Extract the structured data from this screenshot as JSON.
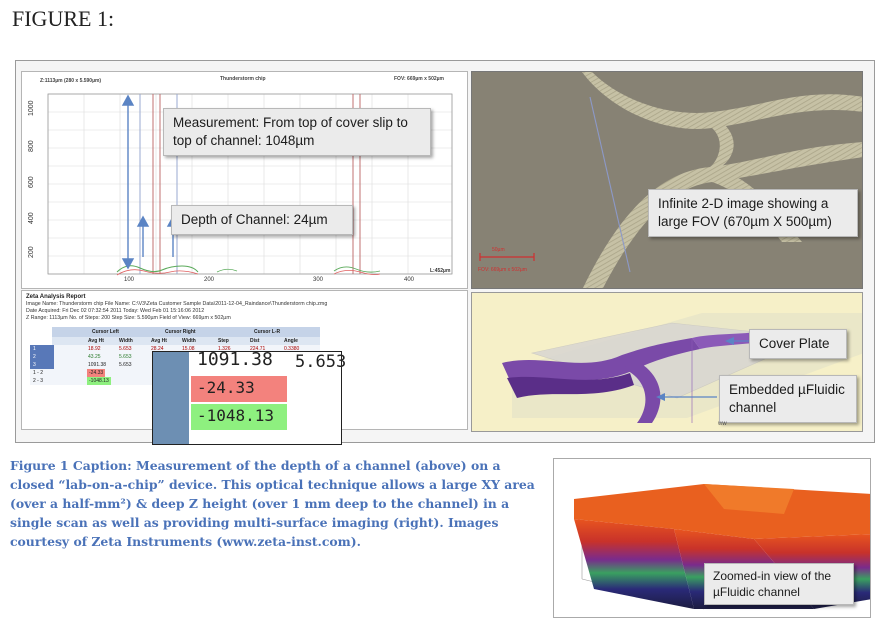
{
  "figure_title": "FIGURE 1:",
  "plot": {
    "left_header": "Z:1113µm (280 x 5.590µm)",
    "center_header": "Thunderstorm chip",
    "right_header": "FOV: 669µm x 502µm",
    "y_ticks": [
      "1000",
      "800",
      "600",
      "400",
      "200"
    ],
    "x_ticks": [
      "100",
      "200",
      "300",
      "400"
    ],
    "length_label": "L:452µm"
  },
  "callouts": {
    "measurement": "Measurement: From top of cover slip to top of channel: 1048µm",
    "depth": "Depth of Channel: 24µm",
    "image": "Infinite 2-D image showing a large FOV (670µm X 500µm)",
    "cover_plate": "Cover Plate",
    "embedded": "Embedded µFluidic channel",
    "zoomed": "Zoomed-in view of the µFluidic channel"
  },
  "image_overlay": {
    "scale_label": "50µm",
    "fov_label": "FOV: 669µm x 502µm"
  },
  "report": {
    "title": "Zeta Analysis Report",
    "line1": "Image Name:  Thunderstorm chip     File Name:      C:\\V3\\Zeta Customer Sample Data\\2011-12-04_Raindance\\Thunderstorm chip.zmg",
    "line2": "Date Acquired:      Fri Dec 02 07:32:54 2011    Today: Wed Feb 01 15:16:06 2012",
    "line3": "Z Range:       1113µm        No. of Steps: 200    Step Size:      5.590µm          Field of View:  669µm x 502µm"
  },
  "table": {
    "groups": [
      "Cursor Left",
      "Cursor Right",
      "Cursor L-R"
    ],
    "columns": [
      "Avg Ht",
      "Width",
      "Avg Ht",
      "Width",
      "Step",
      "Dist",
      "Angle"
    ],
    "rows": [
      {
        "label": "1",
        "c": [
          "18.92",
          "5.653",
          "28.24",
          "15.08",
          "1.326",
          "224.71",
          "0.3380"
        ]
      },
      {
        "label": "2",
        "c": [
          "43.25",
          "5.653",
          "",
          "",
          "",
          "",
          ""
        ]
      },
      {
        "label": "3",
        "c": [
          "1091.38",
          "5.653",
          "",
          "",
          "",
          "",
          ""
        ]
      },
      {
        "label": "1 - 2",
        "c": [
          "-24.33",
          "",
          "",
          "",
          "",
          "",
          ""
        ]
      },
      {
        "label": "2 - 3",
        "c": [
          "-1048.13",
          "",
          "",
          "",
          "",
          "",
          ""
        ]
      }
    ]
  },
  "zoom_table": {
    "top_value": "1091.38",
    "top_right": "5.653",
    "diff1": "-24.33",
    "diff2": "-1048.13"
  },
  "view3d": {
    "watermark": "ww"
  },
  "caption": "Figure 1 Caption: Measurement of the depth of a channel (above) on a closed “lab-on-a-chip” device. This optical technique allows a large XY area (over a half-mm²) & deep Z height (over 1 mm deep to the channel) in a single scan as well as providing multi-surface imaging (right).  Images courtesy of Zeta Instruments (www.zeta-inst.com).",
  "colors": {
    "caption": "#4a72b8",
    "diff1_bg": "#f3827d",
    "diff2_bg": "#8ef07f",
    "purple": "#7a4aa8"
  }
}
